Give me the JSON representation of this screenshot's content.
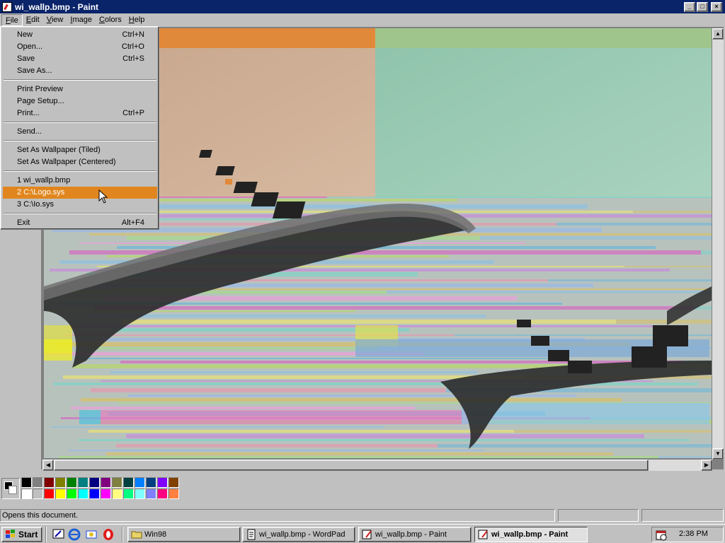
{
  "window": {
    "title": "wi_wallp.bmp - Paint"
  },
  "titlebar_buttons": {
    "minimize": "_",
    "maximize": "□",
    "close": "×"
  },
  "menubar": [
    {
      "label": "File",
      "key": "F",
      "rest": "ile"
    },
    {
      "label": "Edit",
      "key": "E",
      "rest": "dit"
    },
    {
      "label": "View",
      "key": "V",
      "rest": "iew"
    },
    {
      "label": "Image",
      "key": "I",
      "rest": "mage"
    },
    {
      "label": "Colors",
      "key": "C",
      "rest": "olors"
    },
    {
      "label": "Help",
      "key": "H",
      "rest": "elp"
    }
  ],
  "file_menu": {
    "new": {
      "label": "New",
      "shortcut": "Ctrl+N"
    },
    "open": {
      "label": "Open...",
      "shortcut": "Ctrl+O"
    },
    "save": {
      "label": "Save",
      "shortcut": "Ctrl+S"
    },
    "save_as": {
      "label": "Save As..."
    },
    "print_preview": {
      "label": "Print Preview"
    },
    "page_setup": {
      "label": "Page Setup..."
    },
    "print": {
      "label": "Print...",
      "shortcut": "Ctrl+P"
    },
    "send": {
      "label": "Send..."
    },
    "wallpaper_tiled": {
      "label": "Set As Wallpaper (Tiled)"
    },
    "wallpaper_centered": {
      "label": "Set As Wallpaper (Centered)"
    },
    "recent1": {
      "label": "1 wi_wallp.bmp"
    },
    "recent2": {
      "label": "2 C:\\Logo.sys",
      "highlighted": true
    },
    "recent3": {
      "label": "3 C:\\Io.sys"
    },
    "exit": {
      "label": "Exit",
      "shortcut": "Alt+F4"
    }
  },
  "palette": {
    "foreground": "#000000",
    "background": "#ffffff",
    "colors_top": [
      "#000000",
      "#808080",
      "#800000",
      "#808000",
      "#008000",
      "#008080",
      "#000080",
      "#800080",
      "#808040",
      "#004040",
      "#0080ff",
      "#004080",
      "#8000ff",
      "#804000"
    ],
    "colors_bottom": [
      "#ffffff",
      "#c0c0c0",
      "#ff0000",
      "#ffff00",
      "#00ff00",
      "#00ffff",
      "#0000ff",
      "#ff00ff",
      "#ffff80",
      "#00ff80",
      "#80ffff",
      "#8080ff",
      "#ff0080",
      "#ff8040"
    ]
  },
  "statusbar": {
    "text": "Opens this document."
  },
  "taskbar": {
    "start": "Start",
    "quicklaunch": [
      "show-desktop-icon",
      "ie-icon",
      "outlook-icon",
      "opera-icon"
    ],
    "buttons": [
      {
        "label": "Win98",
        "icon": "folder-icon",
        "active": false
      },
      {
        "label": "wi_wallp.bmp - WordPad",
        "icon": "wordpad-icon",
        "active": false
      },
      {
        "label": "wi_wallp.bmp - Paint",
        "icon": "paint-icon",
        "active": false
      },
      {
        "label": "wi_wallp.bmp - Paint",
        "icon": "paint-icon",
        "active": true
      }
    ],
    "clock": "2:38 PM"
  }
}
